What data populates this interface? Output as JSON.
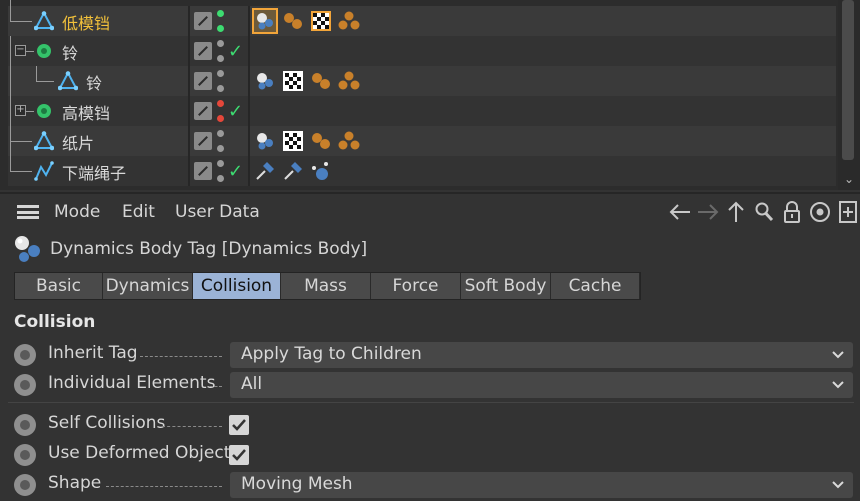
{
  "object_manager": {
    "rows": [
      {
        "label": "低模铛",
        "active": true
      },
      {
        "label": "铃",
        "active": false
      },
      {
        "label": "铃",
        "active": false
      },
      {
        "label": "高模铛",
        "active": false
      },
      {
        "label": "纸片",
        "active": false
      },
      {
        "label": "下端绳子",
        "active": false
      }
    ]
  },
  "menubar": {
    "items": [
      "Mode",
      "Edit",
      "User Data"
    ],
    "icons": [
      "arrow-left-icon",
      "arrow-right-icon",
      "arrow-up-icon",
      "search-icon",
      "lock-icon",
      "target-icon",
      "new-panel-icon"
    ]
  },
  "object_title": "Dynamics Body Tag [Dynamics Body]",
  "tabs": [
    "Basic",
    "Dynamics",
    "Collision",
    "Mass",
    "Force",
    "Soft Body",
    "Cache"
  ],
  "active_tab": "Collision",
  "section_title": "Collision",
  "properties": {
    "inherit_tag": {
      "label": "Inherit Tag",
      "value": "Apply Tag to Children"
    },
    "individual_elements": {
      "label": "Individual Elements",
      "value": "All"
    },
    "self_collisions": {
      "label": "Self Collisions",
      "checked": true
    },
    "use_deformed_object": {
      "label": "Use Deformed Object",
      "checked": true
    },
    "shape": {
      "label": "Shape",
      "value": "Moving Mesh"
    }
  },
  "colors": {
    "active_tab": "#9bb3d6",
    "active_object": "#f2c13a",
    "enabled_green": "#3ddc71",
    "disabled_red": "#e5473a",
    "selection_outline": "#f2a53a"
  }
}
